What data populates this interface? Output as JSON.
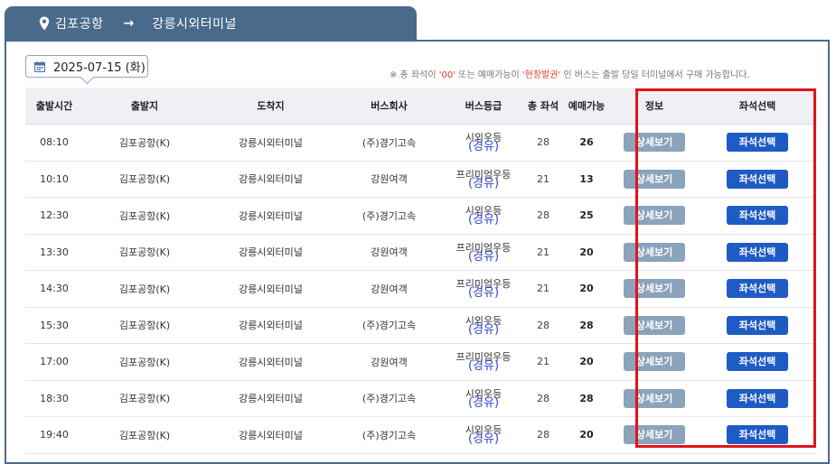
{
  "route": {
    "from": "김포공항",
    "arrow": "→",
    "to": "강릉시외터미널"
  },
  "date": "2025-07-15 (화)",
  "notice": {
    "prefix": "※ 총 좌석이 ",
    "zero": "'00'",
    "middle": " 또는 예매가능이 ",
    "onsite": "'현장발권'",
    "suffix": " 인 버스는 출발 당일 터미널에서 구매 가능합니다."
  },
  "columns": {
    "depart_time": "출발시간",
    "origin": "출발지",
    "destination": "도착지",
    "company": "버스회사",
    "grade": "버스등급",
    "total_seats": "총 좌석",
    "available": "예매가능",
    "info": "정보",
    "seat_select": "좌석선택"
  },
  "buttons": {
    "detail": "상세보기",
    "seat": "좌석선택"
  },
  "rows": [
    {
      "time": "08:10",
      "origin": "김포공항(K)",
      "dest": "강릉시외터미널",
      "company": "(주)경기고속",
      "grade": "시외우등",
      "grade_sub": "(경유)",
      "total": "28",
      "avail": "26"
    },
    {
      "time": "10:10",
      "origin": "김포공항(K)",
      "dest": "강릉시외터미널",
      "company": "강원여객",
      "grade": "프리미엄우등",
      "grade_sub": "(경유)",
      "total": "21",
      "avail": "13"
    },
    {
      "time": "12:30",
      "origin": "김포공항(K)",
      "dest": "강릉시외터미널",
      "company": "(주)경기고속",
      "grade": "시외우등",
      "grade_sub": "(경유)",
      "total": "28",
      "avail": "25"
    },
    {
      "time": "13:30",
      "origin": "김포공항(K)",
      "dest": "강릉시외터미널",
      "company": "강원여객",
      "grade": "프리미엄우등",
      "grade_sub": "(경유)",
      "total": "21",
      "avail": "20"
    },
    {
      "time": "14:30",
      "origin": "김포공항(K)",
      "dest": "강릉시외터미널",
      "company": "강원여객",
      "grade": "프리미엄우등",
      "grade_sub": "(경유)",
      "total": "21",
      "avail": "20"
    },
    {
      "time": "15:30",
      "origin": "김포공항(K)",
      "dest": "강릉시외터미널",
      "company": "(주)경기고속",
      "grade": "시외우등",
      "grade_sub": "(경유)",
      "total": "28",
      "avail": "28"
    },
    {
      "time": "17:00",
      "origin": "김포공항(K)",
      "dest": "강릉시외터미널",
      "company": "강원여객",
      "grade": "프리미엄우등",
      "grade_sub": "(경유)",
      "total": "21",
      "avail": "20"
    },
    {
      "time": "18:30",
      "origin": "김포공항(K)",
      "dest": "강릉시외터미널",
      "company": "(주)경기고속",
      "grade": "시외우등",
      "grade_sub": "(경유)",
      "total": "28",
      "avail": "28"
    },
    {
      "time": "19:40",
      "origin": "김포공항(K)",
      "dest": "강릉시외터미널",
      "company": "(주)경기고속",
      "grade": "시외우등",
      "grade_sub": "(경유)",
      "total": "28",
      "avail": "20"
    }
  ],
  "colors": {
    "header_blue": "#4a6a8c",
    "detail_button": "#8ba3bb",
    "seat_button": "#1f5bc4",
    "highlight_red": "#e2121b",
    "notice_red": "#e03a2f"
  },
  "icons": {
    "route": "map-pin-icon",
    "date": "calendar-icon"
  }
}
